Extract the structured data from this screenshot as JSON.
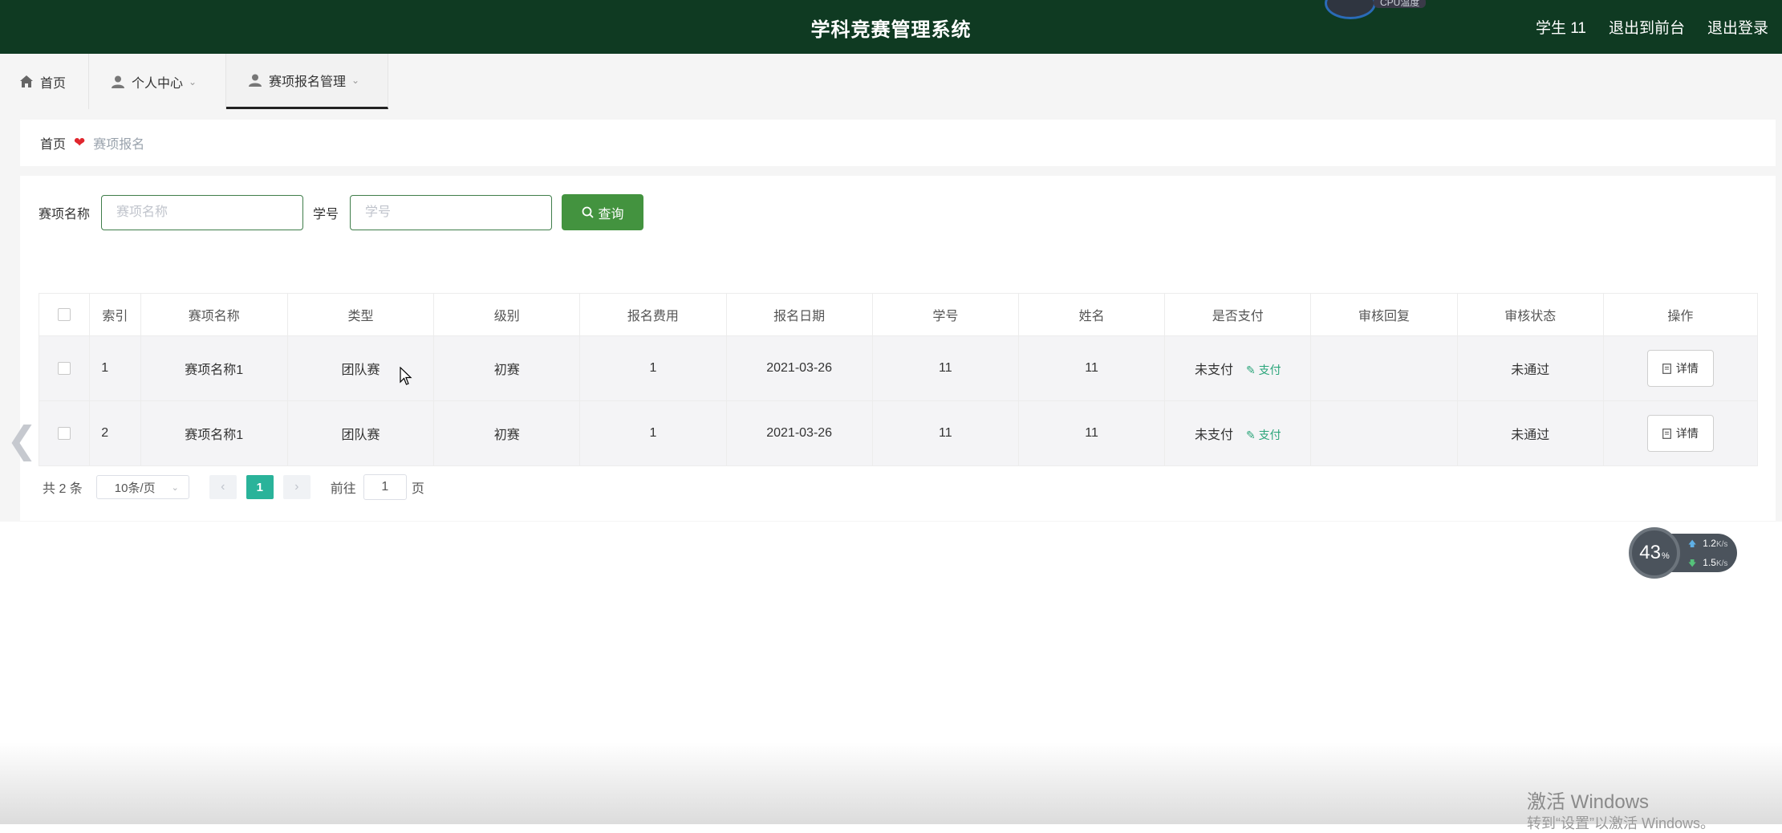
{
  "header": {
    "title": "学科竞赛管理系统",
    "user_label": "学生 11",
    "back_front": "退出到前台",
    "logout": "退出登录",
    "cpu_label": "CPU温度"
  },
  "nav": {
    "tabs": [
      {
        "label": "首页",
        "icon": "home-icon"
      },
      {
        "label": "个人中心",
        "icon": "user-icon"
      },
      {
        "label": "赛项报名管理",
        "icon": "user-icon",
        "active": true
      }
    ]
  },
  "breadcrumb": {
    "home": "首页",
    "current": "赛项报名",
    "separator_color": "#e0262d"
  },
  "search": {
    "name_label": "赛项名称",
    "name_placeholder": "赛项名称",
    "name_value": "",
    "id_label": "学号",
    "id_placeholder": "学号",
    "id_value": "",
    "query_label": "查询"
  },
  "table": {
    "headers": [
      "索引",
      "赛项名称",
      "类型",
      "级别",
      "报名费用",
      "报名日期",
      "学号",
      "姓名",
      "是否支付",
      "审核回复",
      "审核状态",
      "操作"
    ],
    "rows": [
      {
        "index": "1",
        "name": "赛项名称1",
        "type": "团队赛",
        "level": "初赛",
        "fee": "1",
        "date": "2021-03-26",
        "student_id": "11",
        "student_name": "11",
        "paid": "未支付",
        "pay_action": "支付",
        "reply": "",
        "status": "未通过",
        "detail": "详情"
      },
      {
        "index": "2",
        "name": "赛项名称1",
        "type": "团队赛",
        "level": "初赛",
        "fee": "1",
        "date": "2021-03-26",
        "student_id": "11",
        "student_name": "11",
        "paid": "未支付",
        "pay_action": "支付",
        "reply": "",
        "status": "未通过",
        "detail": "详情"
      }
    ]
  },
  "pager": {
    "total": "共 2 条",
    "page_size": "10条/页",
    "current_page": "1",
    "goto_prefix": "前往",
    "goto_value": "1",
    "goto_suffix": "页"
  },
  "speed_widget": {
    "percent": "43",
    "percent_unit": "%",
    "upload": "1.2",
    "download": "1.5",
    "unit": "K/s"
  },
  "watermark": {
    "line1": "激活 Windows",
    "line2": "转到“设置”以激活 Windows。"
  },
  "colors": {
    "header_bg": "#0f3a22",
    "accent_green": "#43933f",
    "pager_active": "#2ab39a",
    "pay_link": "#2aa57a"
  }
}
